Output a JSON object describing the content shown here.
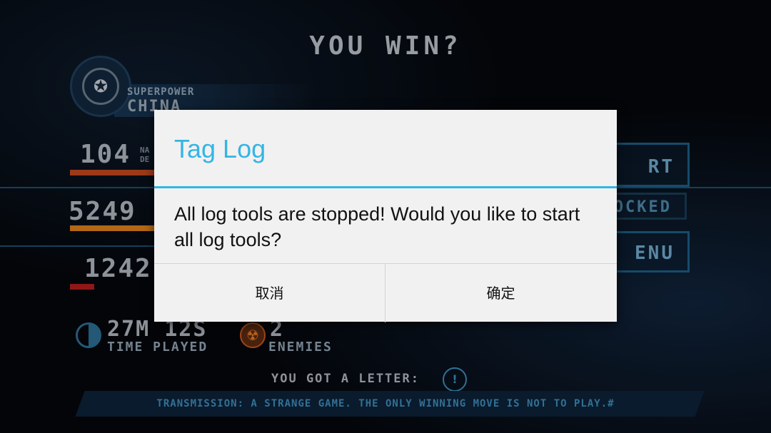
{
  "game": {
    "title": "YOU WIN?",
    "superpower_label": "SUPERPOWER",
    "country": "CHINA",
    "stats": [
      {
        "value": "104",
        "label_partial": "NA\nDE"
      },
      {
        "value": "5249"
      },
      {
        "value": "1242"
      }
    ],
    "right_buttons": [
      {
        "label": "RT"
      },
      {
        "label": "OCKED"
      },
      {
        "label": "ENU"
      }
    ],
    "time_played_value": "27M 12S",
    "time_played_label": "TIME PLAYED",
    "enemies_value": "2",
    "enemies_label": "ENEMIES",
    "letter_label": "YOU GOT A LETTER:",
    "letter_icon_text": "!",
    "transmission": "TRANSMISSION: A STRANGE GAME. THE ONLY WINNING MOVE IS NOT TO PLAY.#",
    "colors": {
      "accent": "#1c5c82",
      "bar1": "#c0461f",
      "bar2": "#d97f1c",
      "bar3": "#b01d1d"
    }
  },
  "dialog": {
    "title": "Tag Log",
    "message": "All log tools are stopped! Would you like to start all log tools?",
    "cancel_label": "取消",
    "ok_label": "确定",
    "accent": "#33b5e5"
  }
}
